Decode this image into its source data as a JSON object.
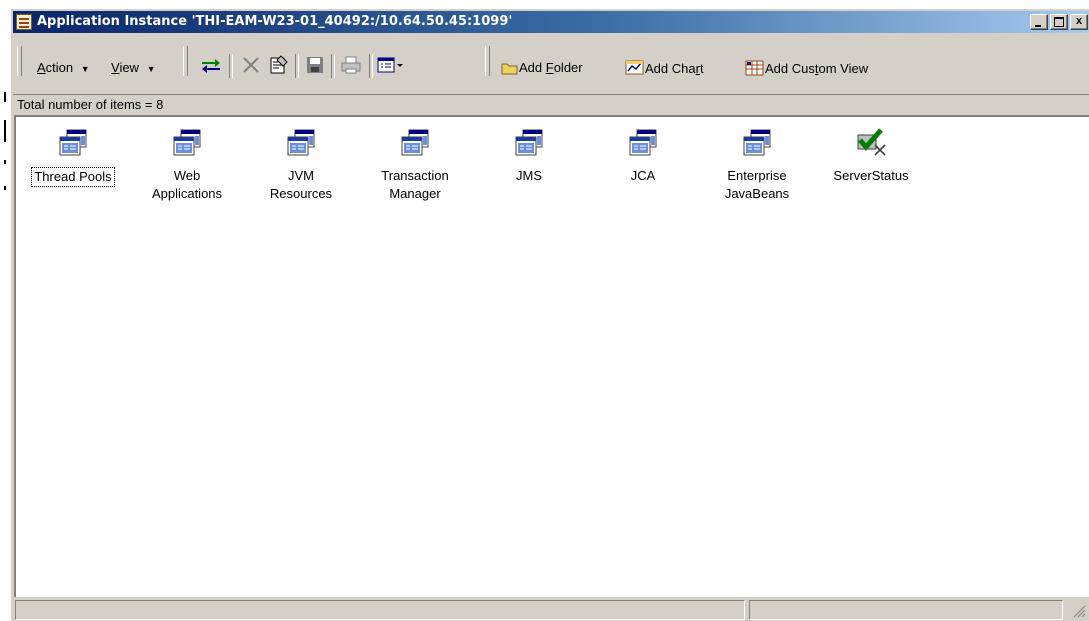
{
  "window": {
    "title": "Application Instance 'THI-EAM-W23-01_40492:/10.64.50.45:1099'",
    "controls": {
      "minimize": "_",
      "maximize": "□",
      "close": "x"
    }
  },
  "toolbar": {
    "action_prefix": "A",
    "action_rest": "ction",
    "view_prefix": "V",
    "view_rest": "iew",
    "add_folder_pre": "Add ",
    "add_folder_u": "F",
    "add_folder_post": "older",
    "add_chart_pre": "Add Cha",
    "add_chart_u": "r",
    "add_chart_post": "t",
    "add_custom_pre": "Add Cus",
    "add_custom_u": "t",
    "add_custom_post": "om View"
  },
  "list_status": "Total number of items = 8",
  "items": [
    {
      "label": "Thread Pools",
      "icon": "window-icon",
      "selected": true
    },
    {
      "label": "Web Applications",
      "icon": "window-icon"
    },
    {
      "label": "JVM Resources",
      "icon": "window-icon"
    },
    {
      "label": "Transaction Manager",
      "icon": "window-icon"
    },
    {
      "label": "JMS",
      "icon": "window-icon"
    },
    {
      "label": "JCA",
      "icon": "window-icon"
    },
    {
      "label": "Enterprise JavaBeans",
      "icon": "window-icon"
    },
    {
      "label": "ServerStatus",
      "icon": "check-x-icon"
    }
  ],
  "colors": {
    "titlebar_start": "#0a246a",
    "titlebar_end": "#a6caf0",
    "chrome": "#d4d0c8"
  }
}
